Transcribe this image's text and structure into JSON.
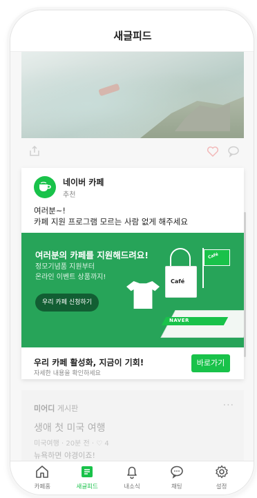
{
  "header": {
    "title": "새글피드"
  },
  "promo": {
    "brand_name": "네이버 카페",
    "brand_sub": "추천",
    "text_line1": "여러분~!",
    "text_line2": "카페 지원 프로그램 모르는 사람 없게 해주세요",
    "banner_title": "여러분의 카페를 지원해드려요!",
    "banner_desc_line1": "정모기념품 지원부터",
    "banner_desc_line2": "온라인 이벤트 상품까지!",
    "banner_button": "우리 카페 신청하기",
    "tote_label": "Café",
    "flag_label": "Café",
    "panel_label": "NAVER",
    "cta_title": "우리 카페 활성화, 지금이 기회!",
    "cta_sub": "자세한 내용을 확인하세요",
    "cta_button": "바로가기"
  },
  "post2": {
    "cafe": "미어디",
    "board": "게시판",
    "more": "···",
    "title": "생애 첫 미국 여행",
    "info": "미국여행 · 20분 전 · ♡ 4",
    "snippet": "뉴욕하면 야경이죠!"
  },
  "tabs": [
    {
      "label": "카페홈",
      "icon": "home-icon"
    },
    {
      "label": "새글피드",
      "icon": "feed-icon",
      "active": true
    },
    {
      "label": "내소식",
      "icon": "bell-icon"
    },
    {
      "label": "채팅",
      "icon": "chat-icon"
    },
    {
      "label": "설정",
      "icon": "gear-icon"
    }
  ],
  "colors": {
    "brand_green": "#19c24a",
    "banner_green": "#27a459",
    "button_dark": "#125e33"
  }
}
